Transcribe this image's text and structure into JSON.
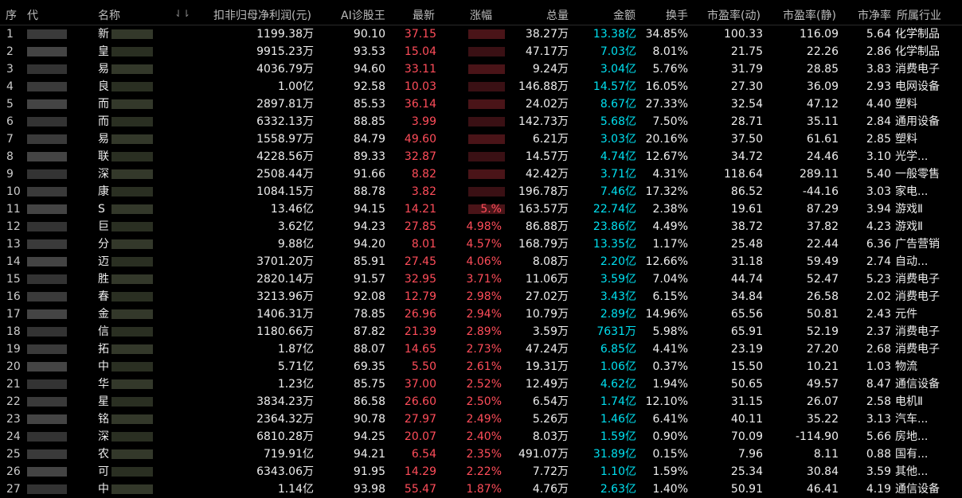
{
  "headers": {
    "seq": "序",
    "code": "代",
    "name": "名称",
    "net_profit": "扣非归母净利润(元)",
    "ai_score": "AI诊股王",
    "latest": "最新",
    "change": "涨幅",
    "total_volume": "总量",
    "amount": "金额",
    "turnover": "换手",
    "pe_dynamic": "市盈率(动)",
    "pe_static": "市盈率(静)",
    "pb": "市净率",
    "industry": "所属行业"
  },
  "colors": {
    "background": "#000000",
    "red": "#ff4d5a",
    "cyan": "#00e0f0",
    "text": "#dddddd"
  },
  "rows": [
    {
      "seq": "1",
      "name": "新",
      "net_profit": "1199.38万",
      "ai": "90.10",
      "latest": "37.15",
      "change": "",
      "vol": "38.27万",
      "amount": "13.38亿",
      "turnover": "34.85%",
      "pe_dyn": "100.33",
      "pe_sta": "116.09",
      "pb": "5.64",
      "industry": "化学制品"
    },
    {
      "seq": "2",
      "name": "皇",
      "net_profit": "9915.23万",
      "ai": "93.53",
      "latest": "15.04",
      "change": "",
      "vol": "47.17万",
      "amount": "7.03亿",
      "turnover": "8.01%",
      "pe_dyn": "21.75",
      "pe_sta": "22.26",
      "pb": "2.86",
      "industry": "化学制品"
    },
    {
      "seq": "3",
      "name": "易",
      "net_profit": "4036.79万",
      "ai": "94.60",
      "latest": "33.11",
      "change": "",
      "vol": "9.24万",
      "amount": "3.04亿",
      "turnover": "5.76%",
      "pe_dyn": "31.79",
      "pe_sta": "28.85",
      "pb": "3.83",
      "industry": "消费电子"
    },
    {
      "seq": "4",
      "name": "良",
      "net_profit": "1.00亿",
      "ai": "92.58",
      "latest": "10.03",
      "change": "",
      "vol": "146.88万",
      "amount": "14.57亿",
      "turnover": "16.05%",
      "pe_dyn": "27.30",
      "pe_sta": "36.09",
      "pb": "2.93",
      "industry": "电网设备"
    },
    {
      "seq": "5",
      "name": "而",
      "net_profit": "2897.81万",
      "ai": "85.53",
      "latest": "36.14",
      "change": "",
      "vol": "24.02万",
      "amount": "8.67亿",
      "turnover": "27.33%",
      "pe_dyn": "32.54",
      "pe_sta": "47.12",
      "pb": "4.40",
      "industry": "塑料"
    },
    {
      "seq": "6",
      "name": "而",
      "net_profit": "6332.13万",
      "ai": "88.85",
      "latest": "3.99",
      "change": "",
      "vol": "142.73万",
      "amount": "5.68亿",
      "turnover": "7.50%",
      "pe_dyn": "28.71",
      "pe_sta": "35.11",
      "pb": "2.84",
      "industry": "通用设备"
    },
    {
      "seq": "7",
      "name": "易",
      "net_profit": "1558.97万",
      "ai": "84.79",
      "latest": "49.60",
      "change": "",
      "vol": "6.21万",
      "amount": "3.03亿",
      "turnover": "20.16%",
      "pe_dyn": "37.50",
      "pe_sta": "61.61",
      "pb": "2.85",
      "industry": "塑料"
    },
    {
      "seq": "8",
      "name": "联",
      "net_profit": "4228.56万",
      "ai": "89.33",
      "latest": "32.87",
      "change": "",
      "vol": "14.57万",
      "amount": "4.74亿",
      "turnover": "12.67%",
      "pe_dyn": "34.72",
      "pe_sta": "24.46",
      "pb": "3.10",
      "industry": "光学..."
    },
    {
      "seq": "9",
      "name": "深",
      "net_profit": "2508.44万",
      "ai": "91.66",
      "latest": "8.82",
      "change": "",
      "vol": "42.42万",
      "amount": "3.71亿",
      "turnover": "4.31%",
      "pe_dyn": "118.64",
      "pe_sta": "289.11",
      "pb": "5.40",
      "industry": "一般零售"
    },
    {
      "seq": "10",
      "name": "康",
      "net_profit": "1084.15万",
      "ai": "88.78",
      "latest": "3.82",
      "change": "",
      "vol": "196.78万",
      "amount": "7.46亿",
      "turnover": "17.32%",
      "pe_dyn": "86.52",
      "pe_sta": "-44.16",
      "pb": "3.03",
      "industry": "家电..."
    },
    {
      "seq": "11",
      "name": "S",
      "net_profit": "13.46亿",
      "ai": "94.15",
      "latest": "14.21",
      "change": "5.%",
      "vol": "163.57万",
      "amount": "22.74亿",
      "turnover": "2.38%",
      "pe_dyn": "19.61",
      "pe_sta": "87.29",
      "pb": "3.94",
      "industry": "游戏Ⅱ"
    },
    {
      "seq": "12",
      "name": "巨",
      "net_profit": "3.62亿",
      "ai": "94.23",
      "latest": "27.85",
      "change": "4.98%",
      "vol": "86.88万",
      "amount": "23.86亿",
      "turnover": "4.49%",
      "pe_dyn": "38.72",
      "pe_sta": "37.82",
      "pb": "4.23",
      "industry": "游戏Ⅱ"
    },
    {
      "seq": "13",
      "name": "分",
      "net_profit": "9.88亿",
      "ai": "94.20",
      "latest": "8.01",
      "change": "4.57%",
      "vol": "168.79万",
      "amount": "13.35亿",
      "turnover": "1.17%",
      "pe_dyn": "25.48",
      "pe_sta": "22.44",
      "pb": "6.36",
      "industry": "广告营销"
    },
    {
      "seq": "14",
      "name": "迈",
      "net_profit": "3701.20万",
      "ai": "85.91",
      "latest": "27.45",
      "change": "4.06%",
      "vol": "8.08万",
      "amount": "2.20亿",
      "turnover": "12.66%",
      "pe_dyn": "31.18",
      "pe_sta": "59.49",
      "pb": "2.74",
      "industry": "自动..."
    },
    {
      "seq": "15",
      "name": "胜",
      "net_profit": "2820.14万",
      "ai": "91.57",
      "latest": "32.95",
      "change": "3.71%",
      "vol": "11.06万",
      "amount": "3.59亿",
      "turnover": "7.04%",
      "pe_dyn": "44.74",
      "pe_sta": "52.47",
      "pb": "5.23",
      "industry": "消费电子"
    },
    {
      "seq": "16",
      "name": "春",
      "net_profit": "3213.96万",
      "ai": "92.08",
      "latest": "12.79",
      "change": "2.98%",
      "vol": "27.02万",
      "amount": "3.43亿",
      "turnover": "6.15%",
      "pe_dyn": "34.84",
      "pe_sta": "26.58",
      "pb": "2.02",
      "industry": "消费电子"
    },
    {
      "seq": "17",
      "name": "金",
      "net_profit": "1406.31万",
      "ai": "78.85",
      "latest": "26.96",
      "change": "2.94%",
      "vol": "10.79万",
      "amount": "2.89亿",
      "turnover": "14.96%",
      "pe_dyn": "65.56",
      "pe_sta": "50.81",
      "pb": "2.43",
      "industry": "元件"
    },
    {
      "seq": "18",
      "name": "信",
      "net_profit": "1180.66万",
      "ai": "87.82",
      "latest": "21.39",
      "change": "2.89%",
      "vol": "3.59万",
      "amount": "7631万",
      "turnover": "5.98%",
      "pe_dyn": "65.91",
      "pe_sta": "52.19",
      "pb": "2.37",
      "industry": "消费电子"
    },
    {
      "seq": "19",
      "name": "拓",
      "net_profit": "1.87亿",
      "ai": "88.07",
      "latest": "14.65",
      "change": "2.73%",
      "vol": "47.24万",
      "amount": "6.85亿",
      "turnover": "4.41%",
      "pe_dyn": "23.19",
      "pe_sta": "27.20",
      "pb": "2.68",
      "industry": "消费电子"
    },
    {
      "seq": "20",
      "name": "中",
      "net_profit": "5.71亿",
      "ai": "69.35",
      "latest": "5.50",
      "change": "2.61%",
      "vol": "19.31万",
      "amount": "1.06亿",
      "turnover": "0.37%",
      "pe_dyn": "15.50",
      "pe_sta": "10.21",
      "pb": "1.03",
      "industry": "物流"
    },
    {
      "seq": "21",
      "name": "华",
      "net_profit": "1.23亿",
      "ai": "85.75",
      "latest": "37.00",
      "change": "2.52%",
      "vol": "12.49万",
      "amount": "4.62亿",
      "turnover": "1.94%",
      "pe_dyn": "50.65",
      "pe_sta": "49.57",
      "pb": "8.47",
      "industry": "通信设备"
    },
    {
      "seq": "22",
      "name": "星",
      "net_profit": "3834.23万",
      "ai": "86.58",
      "latest": "26.60",
      "change": "2.50%",
      "vol": "6.54万",
      "amount": "1.74亿",
      "turnover": "12.10%",
      "pe_dyn": "31.15",
      "pe_sta": "26.07",
      "pb": "2.58",
      "industry": "电机Ⅱ"
    },
    {
      "seq": "23",
      "name": "铭",
      "net_profit": "2364.32万",
      "ai": "90.78",
      "latest": "27.97",
      "change": "2.49%",
      "vol": "5.26万",
      "amount": "1.46亿",
      "turnover": "6.41%",
      "pe_dyn": "40.11",
      "pe_sta": "35.22",
      "pb": "3.13",
      "industry": "汽车..."
    },
    {
      "seq": "24",
      "name": "深",
      "net_profit": "6810.28万",
      "ai": "94.25",
      "latest": "20.07",
      "change": "2.40%",
      "vol": "8.03万",
      "amount": "1.59亿",
      "turnover": "0.90%",
      "pe_dyn": "70.09",
      "pe_sta": "-114.90",
      "pb": "5.66",
      "industry": "房地..."
    },
    {
      "seq": "25",
      "name": "农",
      "net_profit": "719.91亿",
      "ai": "94.21",
      "latest": "6.54",
      "change": "2.35%",
      "vol": "491.07万",
      "amount": "31.89亿",
      "turnover": "0.15%",
      "pe_dyn": "7.96",
      "pe_sta": "8.11",
      "pb": "0.88",
      "industry": "国有..."
    },
    {
      "seq": "26",
      "name": "可",
      "net_profit": "6343.06万",
      "ai": "91.95",
      "latest": "14.29",
      "change": "2.22%",
      "vol": "7.72万",
      "amount": "1.10亿",
      "turnover": "1.59%",
      "pe_dyn": "25.34",
      "pe_sta": "30.84",
      "pb": "3.59",
      "industry": "其他..."
    },
    {
      "seq": "27",
      "name": "中",
      "net_profit": "1.14亿",
      "ai": "93.98",
      "latest": "55.47",
      "change": "1.87%",
      "vol": "4.76万",
      "amount": "2.63亿",
      "turnover": "1.40%",
      "pe_dyn": "50.91",
      "pe_sta": "46.41",
      "pb": "4.19",
      "industry": "通信设备"
    }
  ]
}
